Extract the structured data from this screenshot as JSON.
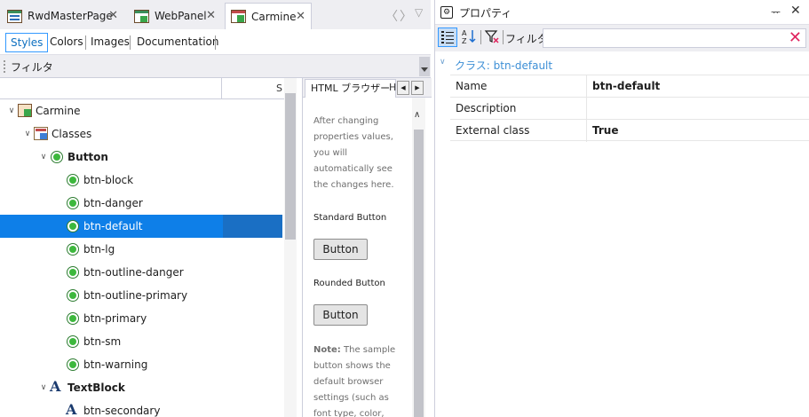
{
  "doc_tabs": [
    {
      "label": "RwdMasterPage",
      "icon": "web-layout-icon"
    },
    {
      "label": "WebPanel",
      "icon": "web-panel-icon"
    },
    {
      "label": "Carmine",
      "icon": "theme-icon"
    }
  ],
  "sub_tabs": [
    "Styles",
    "Colors",
    "Images",
    "Documentation"
  ],
  "filter_label": "フィルタ",
  "col_header_second": "S",
  "tree": [
    {
      "label": "Carmine",
      "level": 0,
      "icon": "theme-icon",
      "expanded": true
    },
    {
      "label": "Classes",
      "level": 1,
      "icon": "classes-icon",
      "expanded": true
    },
    {
      "label": "Button",
      "level": 2,
      "icon": "class-radio-icon",
      "expanded": true,
      "bold": true
    },
    {
      "label": "btn-block",
      "level": 3,
      "icon": "class-radio-icon"
    },
    {
      "label": "btn-danger",
      "level": 3,
      "icon": "class-radio-icon"
    },
    {
      "label": "btn-default",
      "level": 3,
      "icon": "class-radio-icon",
      "selected": true
    },
    {
      "label": "btn-lg",
      "level": 3,
      "icon": "class-radio-icon"
    },
    {
      "label": "btn-outline-danger",
      "level": 3,
      "icon": "class-radio-icon"
    },
    {
      "label": "btn-outline-primary",
      "level": 3,
      "icon": "class-radio-icon"
    },
    {
      "label": "btn-primary",
      "level": 3,
      "icon": "class-radio-icon"
    },
    {
      "label": "btn-sm",
      "level": 3,
      "icon": "class-radio-icon"
    },
    {
      "label": "btn-warning",
      "level": 3,
      "icon": "class-radio-icon"
    },
    {
      "label": "TextBlock",
      "level": 2,
      "icon": "textblock-icon",
      "expanded": true,
      "bold": true
    },
    {
      "label": "btn-secondary",
      "level": 3,
      "icon": "textblock-icon"
    }
  ],
  "preview": {
    "tab_label": "HTML ブラウザー",
    "tab2_label": "H",
    "intro_lines": [
      "After changing",
      "properties values,",
      "you will",
      "automatically see",
      "the changes here."
    ],
    "standard_label": "Standard Button",
    "button_label": "Button",
    "rounded_label": "Rounded Button",
    "note_bold": "Note:",
    "note_lines": [
      " The sample",
      "button shows the",
      "default browser",
      "settings (such as",
      "font type, color,"
    ]
  },
  "properties": {
    "title": "プロパティ",
    "filter_label": "フィルタ",
    "category": "クラス: btn-default",
    "rows": [
      {
        "key": "Name",
        "value": "btn-default"
      },
      {
        "key": "Description",
        "value": ""
      },
      {
        "key": "External class",
        "value": "True"
      }
    ]
  },
  "colors": {
    "selection": "#0e7fe8",
    "accent": "#3399ff",
    "category_text": "#3d8fd6",
    "clear_icon": "#e0245e"
  }
}
